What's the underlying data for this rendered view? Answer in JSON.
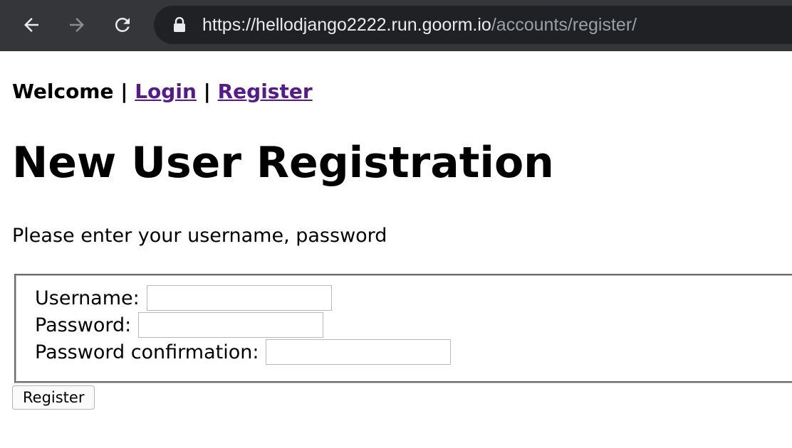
{
  "browser": {
    "url_host": "https://hellodjango2222.run.goorm.io",
    "url_path": "/accounts/register/"
  },
  "nav": {
    "welcome": "Welcome",
    "separator": "|",
    "login": "Login",
    "register": "Register"
  },
  "page": {
    "title": "New User Registration",
    "intro": "Please enter your username, password"
  },
  "form": {
    "username_label": "Username:",
    "username_value": "",
    "password_label": "Password:",
    "password_value": "",
    "confirm_label": "Password confirmation:",
    "confirm_value": "",
    "submit_label": "Register"
  },
  "colors": {
    "chrome_bg": "#35363a",
    "omnibox_bg": "#202124",
    "link_visited": "#551a8b"
  }
}
